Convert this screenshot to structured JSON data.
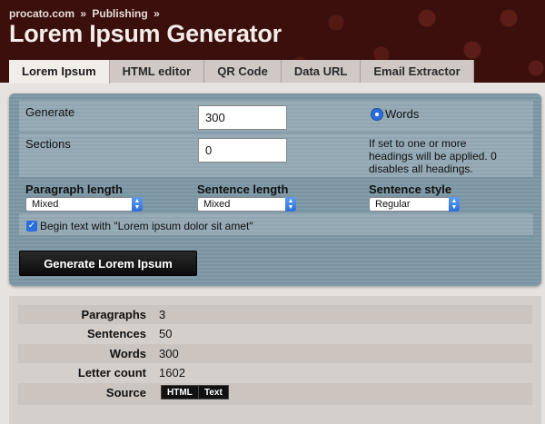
{
  "header": {
    "breadcrumb": [
      "procato.com",
      "Publishing"
    ],
    "breadcrumb_sep": "»",
    "title": "Lorem Ipsum Generator"
  },
  "tabs": [
    {
      "label": "Lorem Ipsum",
      "active": true
    },
    {
      "label": "HTML editor",
      "active": false
    },
    {
      "label": "QR Code",
      "active": false
    },
    {
      "label": "Data URL",
      "active": false
    },
    {
      "label": "Email Extractor",
      "active": false
    }
  ],
  "form": {
    "generate_label": "Generate",
    "generate_value": "300",
    "unit_option": "Words",
    "sections_label": "Sections",
    "sections_value": "0",
    "sections_note": [
      "If set to one or more",
      "headings will be applied. 0",
      "disables all headings."
    ],
    "paragraph_length_label": "Paragraph length",
    "paragraph_length_value": "Mixed",
    "sentence_length_label": "Sentence length",
    "sentence_length_value": "Mixed",
    "sentence_style_label": "Sentence style",
    "sentence_style_value": "Regular",
    "begin_text_label": "Begin text with \"Lorem ipsum dolor sit amet\"",
    "begin_text_checked": true,
    "generate_button": "Generate Lorem Ipsum"
  },
  "stats": [
    {
      "key": "Paragraphs",
      "value": "3"
    },
    {
      "key": "Sentences",
      "value": "50"
    },
    {
      "key": "Words",
      "value": "300"
    },
    {
      "key": "Letter count",
      "value": "1602"
    },
    {
      "key": "Source",
      "value": ""
    }
  ],
  "source_buttons": [
    "HTML",
    "Text"
  ],
  "colors": {
    "header_bg": "#3a0f0c",
    "panel_bg": "#7e98a6",
    "accent": "#2a6ede"
  }
}
